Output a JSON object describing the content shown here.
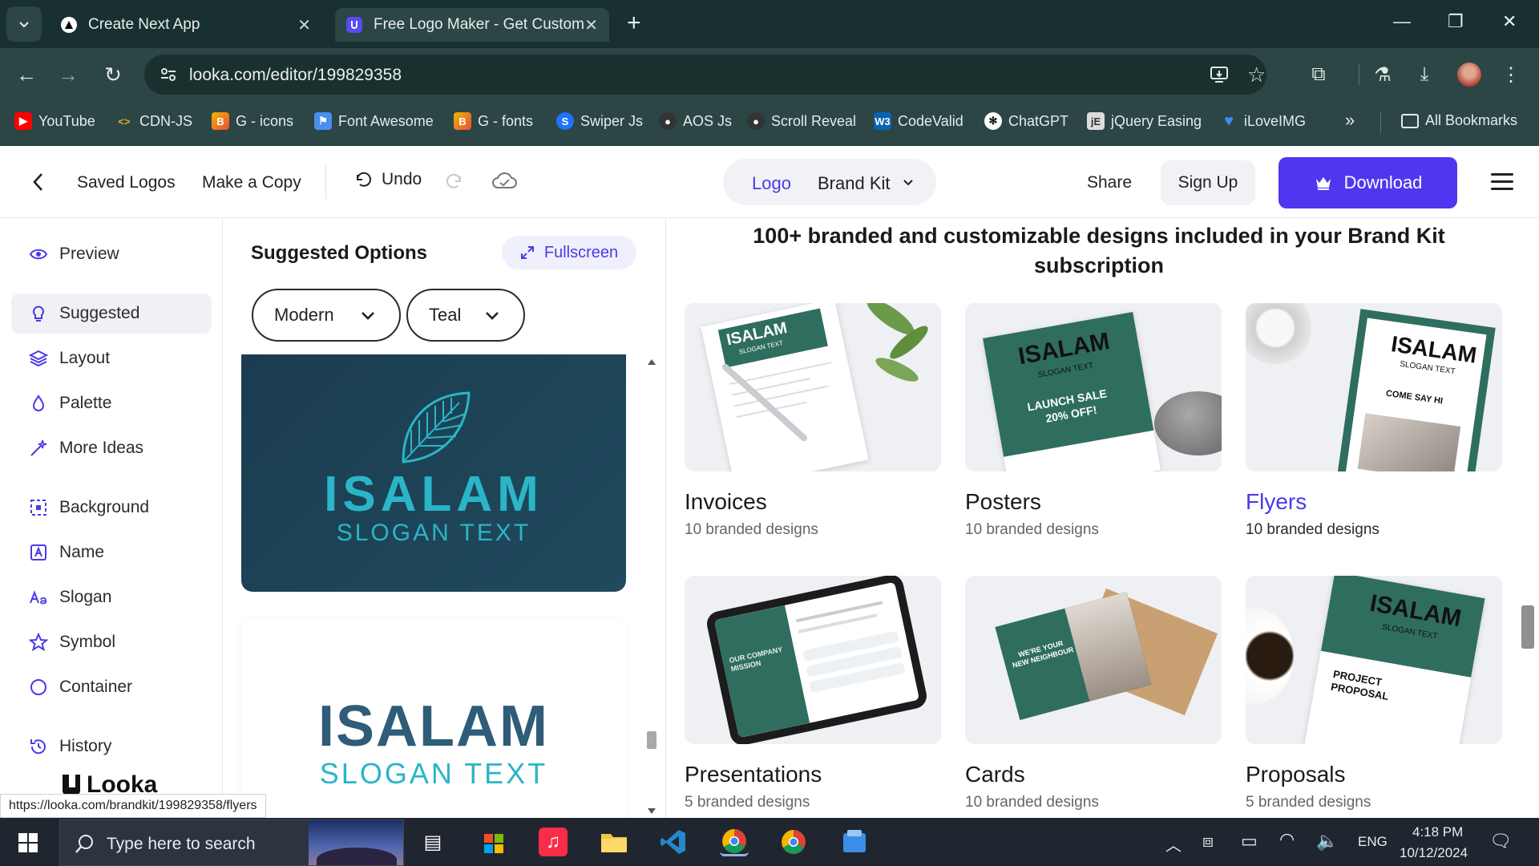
{
  "browser": {
    "tabs": [
      {
        "title": "Create Next App",
        "active": false
      },
      {
        "title": "Free Logo Maker - Get Custom",
        "active": true
      }
    ],
    "url": "looka.com/editor/199829358",
    "bookmarks": [
      {
        "label": "YouTube",
        "icon": "youtube-icon",
        "color": "#ff0000"
      },
      {
        "label": "CDN-JS",
        "icon": "code-icon",
        "color": "#e8a33d"
      },
      {
        "label": "G - icons",
        "icon": "g-icons-icon",
        "color": "#f0b400"
      },
      {
        "label": "Font Awesome",
        "icon": "flag-icon",
        "color": "#4a8ef0"
      },
      {
        "label": "G - fonts",
        "icon": "g-fonts-icon",
        "color": "#f0b400"
      },
      {
        "label": "Swiper Js",
        "icon": "swiper-icon",
        "color": "#1e73ff"
      },
      {
        "label": "AOS Js",
        "icon": "github-icon",
        "color": "#333333"
      },
      {
        "label": "Scroll Reveal",
        "icon": "github-icon",
        "color": "#333333"
      },
      {
        "label": "CodeValid",
        "icon": "w3-icon",
        "color": "#0a62b0"
      },
      {
        "label": "ChatGPT",
        "icon": "chatgpt-icon",
        "color": "#ffffff"
      },
      {
        "label": "jQuery Easing",
        "icon": "jquery-icon",
        "color": "#dddddd"
      },
      {
        "label": "iLoveIMG",
        "icon": "heart-icon",
        "color": "#3d8bf0"
      }
    ],
    "more_label": "»",
    "all_bookmarks": "All Bookmarks"
  },
  "header": {
    "saved_logos": "Saved Logos",
    "make_copy": "Make a Copy",
    "undo": "Undo",
    "mode_logo": "Logo",
    "mode_brand_kit": "Brand Kit",
    "share": "Share",
    "sign_up": "Sign Up",
    "download": "Download"
  },
  "sidebar": {
    "items": [
      {
        "label": "Preview",
        "icon": "eye-icon"
      },
      {
        "label": "Suggested",
        "icon": "bulb-icon",
        "active": true
      },
      {
        "label": "Layout",
        "icon": "layers-icon"
      },
      {
        "label": "Palette",
        "icon": "drop-icon"
      },
      {
        "label": "More Ideas",
        "icon": "wand-icon"
      },
      {
        "label": "Background",
        "icon": "background-icon"
      },
      {
        "label": "Name",
        "icon": "name-icon"
      },
      {
        "label": "Slogan",
        "icon": "slogan-icon"
      },
      {
        "label": "Symbol",
        "icon": "star-icon"
      },
      {
        "label": "Container",
        "icon": "circle-icon"
      },
      {
        "label": "History",
        "icon": "history-icon"
      }
    ],
    "brand": "Looka"
  },
  "panel": {
    "title": "Suggested Options",
    "fullscreen": "Fullscreen",
    "style_value": "Modern",
    "color_value": "Teal",
    "logos": [
      {
        "name": "ISALAM",
        "slogan": "SLOGAN TEXT"
      },
      {
        "name": "ISALAM",
        "slogan": "SLOGAN TEXT"
      }
    ]
  },
  "content": {
    "heading": "100+ branded and customizable designs included in your Brand Kit subscription",
    "tiles": [
      {
        "name": "Invoices",
        "count": "10 branded designs"
      },
      {
        "name": "Posters",
        "count": "10 branded designs"
      },
      {
        "name": "Flyers",
        "count": "10 branded designs"
      },
      {
        "name": "Presentations",
        "count": "5 branded designs"
      },
      {
        "name": "Cards",
        "count": "10 branded designs"
      },
      {
        "name": "Proposals",
        "count": "5 branded designs"
      }
    ],
    "mock": {
      "brand": "ISALAM",
      "slogan": "SLOGAN TEXT",
      "launch_sale": "LAUNCH SALE",
      "off": "20% OFF!",
      "come_say_hi": "COME SAY HI",
      "our_company_mission": "OUR COMPANY MISSION",
      "were_your_new_neighbour": "WE'RE YOUR NEW NEIGHBOUR",
      "project_proposal": "PROJECT PROPOSAL"
    }
  },
  "status_url": "https://looka.com/brandkit/199829358/flyers",
  "taskbar": {
    "search_placeholder": "Type here to search",
    "language": "ENG",
    "time": "4:18 PM",
    "date": "10/12/2024"
  },
  "colors": {
    "accent": "#4a3ae8",
    "download_bg": "#5136f0",
    "brand_teal": "#2f6e5e"
  }
}
